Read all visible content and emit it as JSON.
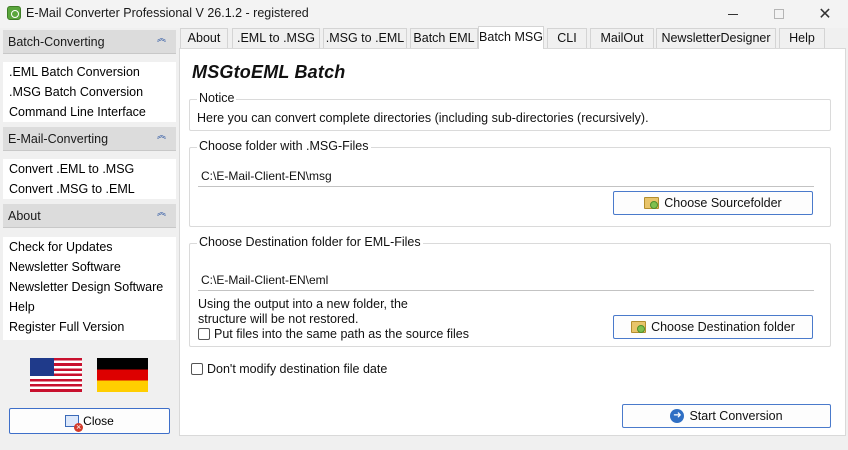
{
  "window": {
    "title": "E-Mail Converter Professional V 26.1.2 - registered",
    "controls": {
      "minimize": "—",
      "maximize": "☐",
      "close": "✕"
    }
  },
  "sidebar": {
    "groups": [
      {
        "title": "Batch-Converting",
        "items": [
          ".EML Batch Conversion",
          ".MSG Batch Conversion",
          "Command Line Interface"
        ]
      },
      {
        "title": "E-Mail-Converting",
        "items": [
          "Convert .EML to .MSG",
          "Convert .MSG to .EML"
        ]
      },
      {
        "title": "About",
        "items": [
          "Check for Updates",
          "Newsletter Software",
          "Newsletter Design Software",
          "Help",
          "Register Full Version"
        ]
      }
    ],
    "collapse_glyph": "︽",
    "close_label": "Close"
  },
  "tabs": [
    {
      "label": "About",
      "active": false
    },
    {
      "label": ".EML to .MSG",
      "active": false
    },
    {
      "label": ".MSG to .EML",
      "active": false
    },
    {
      "label": "Batch EML",
      "active": false
    },
    {
      "label": "Batch MSG",
      "active": true
    },
    {
      "label": "CLI",
      "active": false
    },
    {
      "label": "MailOut",
      "active": false
    },
    {
      "label": "NewsletterDesigner",
      "active": false
    },
    {
      "label": "Help",
      "active": false
    }
  ],
  "main": {
    "title": "MSGtoEML Batch",
    "notice": {
      "legend": "Notice",
      "text": "Here you can convert complete directories (including sub-directories (recursively)."
    },
    "source": {
      "legend": "Choose folder with .MSG-Files",
      "path": "C:\\E-Mail-Client-EN\\msg",
      "button": "Choose Sourcefolder"
    },
    "destination": {
      "legend": "Choose Destination folder for EML-Files",
      "path": "C:\\E-Mail-Client-EN\\eml",
      "info_line1": "Using the output into a new folder, the",
      "info_line2": "structure will be not restored.",
      "same_path_label": "Put files into the same path as the source files",
      "same_path_checked": false,
      "button": "Choose Destination folder"
    },
    "dont_modify_label": "Don't modify destination file date",
    "dont_modify_checked": false,
    "start_button": "Start Conversion"
  },
  "colors": {
    "accent_border": "#4a7acb",
    "group_header_bg": "#dcdcdc",
    "collapse_glyph": "#1c4a9e"
  }
}
